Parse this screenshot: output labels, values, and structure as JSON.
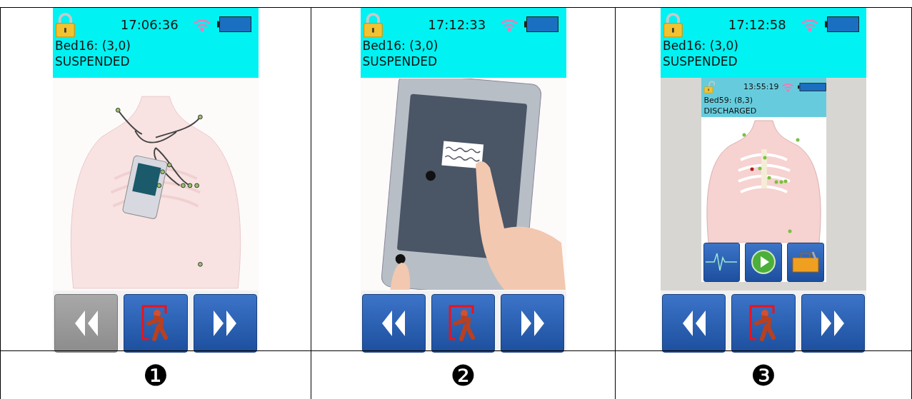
{
  "panels": [
    {
      "screen": {
        "locked": true,
        "time": "17:06:36",
        "bed": "Bed16: (3,0)",
        "status": "SUSPENDED",
        "illustration": {
          "kind": "chest"
        },
        "buttons": [
          {
            "kind": "back",
            "disabled": true
          },
          {
            "kind": "exit",
            "disabled": false
          },
          {
            "kind": "forward",
            "disabled": false
          }
        ]
      },
      "caption": "❶"
    },
    {
      "screen": {
        "locked": true,
        "time": "17:12:33",
        "bed": "Bed16: (3,0)",
        "status": "SUSPENDED",
        "illustration": {
          "kind": "device"
        },
        "buttons": [
          {
            "kind": "back",
            "disabled": false
          },
          {
            "kind": "exit",
            "disabled": false
          },
          {
            "kind": "forward",
            "disabled": false
          }
        ]
      },
      "caption": "❷"
    },
    {
      "screen": {
        "locked": true,
        "time": "17:12:58",
        "bed": "Bed16: (3,0)",
        "status": "SUSPENDED",
        "illustration": {
          "kind": "inner_screen",
          "screen": {
            "locked": false,
            "time": "13:55:19",
            "bed": "Bed59: (8,3)",
            "status": "DISCHARGED",
            "buttons": [
              {
                "kind": "ecg"
              },
              {
                "kind": "play"
              },
              {
                "kind": "toolbox"
              }
            ]
          }
        },
        "buttons": [
          {
            "kind": "back",
            "disabled": false
          },
          {
            "kind": "exit",
            "disabled": false
          },
          {
            "kind": "forward",
            "disabled": false
          }
        ]
      },
      "caption": "❸"
    }
  ]
}
